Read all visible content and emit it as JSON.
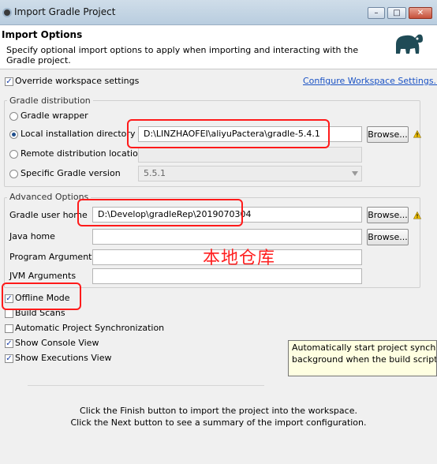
{
  "window": {
    "title": "Import Gradle Project",
    "buttons": {
      "minimize": "–",
      "maximize": "□",
      "close": "✕"
    }
  },
  "header": {
    "title": "Import Options",
    "description": "Specify optional import options to apply when importing and interacting with the Gradle project."
  },
  "override": {
    "label": "Override workspace settings",
    "checked": true,
    "link": "Configure Workspace Settings..."
  },
  "distribution": {
    "group_title": "Gradle distribution",
    "wrapper_label": "Gradle wrapper",
    "local_label": "Local installation directory",
    "local_value": "D:\\LINZHAOFEI\\aliyuPactera\\gradle-5.4.1",
    "remote_label": "Remote distribution location",
    "remote_value": "",
    "version_label": "Specific Gradle version",
    "version_value": "5.5.1",
    "browse_label": "Browse...",
    "selected": "local"
  },
  "advanced": {
    "group_title": "Advanced Options",
    "user_home_label": "Gradle user home",
    "user_home_value": "D:\\Develop\\gradleRep\\2019070304",
    "java_home_label": "Java home",
    "java_home_value": "",
    "program_args_label": "Program Arguments",
    "program_args_value": "",
    "jvm_args_label": "JVM Arguments",
    "jvm_args_value": "",
    "browse_label": "Browse..."
  },
  "options": {
    "offline": {
      "label": "Offline Mode",
      "checked": true
    },
    "build_scans": {
      "label": "Build Scans",
      "checked": false
    },
    "auto_sync": {
      "label": "Automatic Project Synchronization",
      "checked": false
    },
    "console_view": {
      "label": "Show Console View",
      "checked": true
    },
    "executions_view": {
      "label": "Show Executions View",
      "checked": true
    }
  },
  "tooltip": {
    "line1": "Automatically start project synchroniz",
    "line2": " background when the build script ch"
  },
  "annotation": {
    "text": "本地仓库",
    "color": "#ff2020"
  },
  "footer": {
    "line1": "Click the Finish button to import the project into the workspace.",
    "line2": "Click the Next button to see a summary of the import configuration."
  },
  "colors": {
    "link": "#1a52c4",
    "highlight_box": "#ff1a1a",
    "tooltip_bg": "#ffffe1"
  }
}
